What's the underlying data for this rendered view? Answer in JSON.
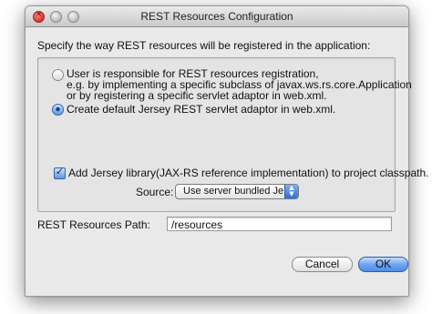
{
  "window": {
    "title": "REST Resources Configuration"
  },
  "instruction": "Specify the way REST resources will be registered in the application:",
  "options": [
    {
      "line1": "User is responsible for REST resources registration,",
      "line2": "e.g. by implementing a specific subclass of javax.ws.rs.core.Application",
      "line3": "or by registering a specific servlet adaptor in web.xml.",
      "selected": false
    },
    {
      "line1": "Create default Jersey REST servlet adaptor in web.xml.",
      "selected": true
    }
  ],
  "checkbox": {
    "label": "Add Jersey library(JAX-RS reference implementation) to project classpath.",
    "checked": true
  },
  "source": {
    "label": "Source:",
    "value": "Use server bundled Je..."
  },
  "rest_path": {
    "label": "REST Resources Path:",
    "value": "/resources"
  },
  "buttons": {
    "cancel": "Cancel",
    "ok": "OK"
  },
  "colors": {
    "accent": "#5f95de",
    "window_bg": "#e9e9e9"
  }
}
